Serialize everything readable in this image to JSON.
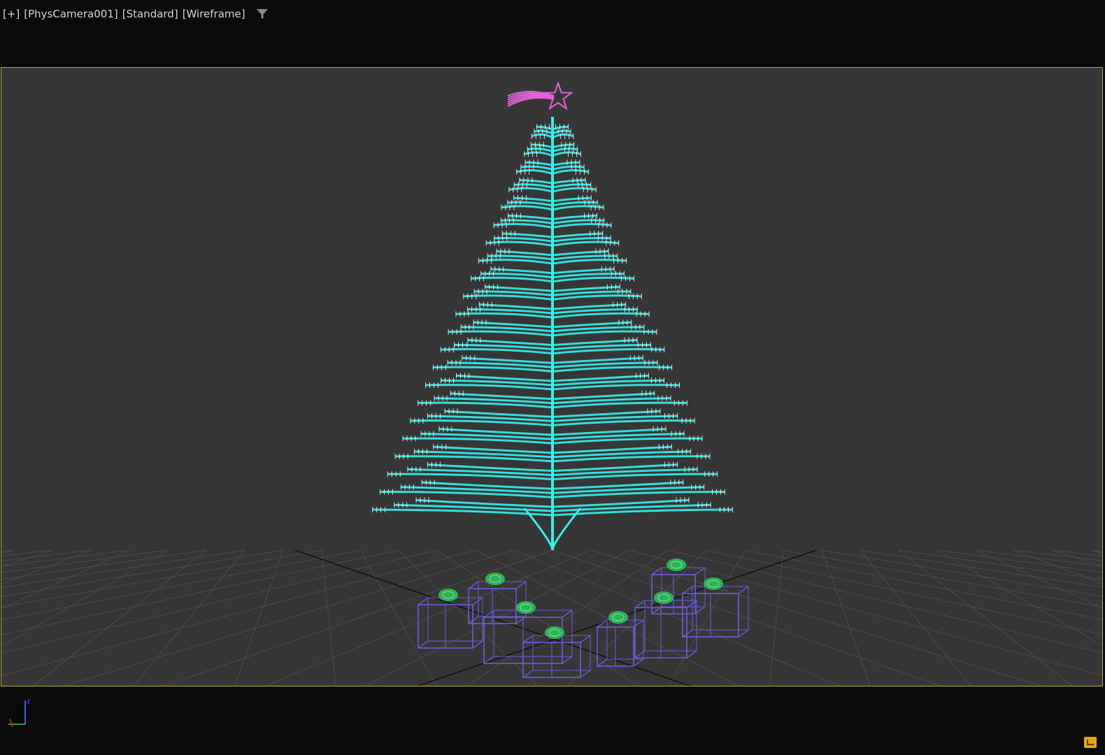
{
  "viewport": {
    "plus_label": "[+]",
    "camera_label": "[PhysCamera001]",
    "shading_label": "[Standard]",
    "mode_label": "[Wireframe]",
    "filter_icon": "funnel-icon"
  },
  "axis": {
    "z_label": "z"
  },
  "colors": {
    "background": "#0a0a0a",
    "viewport_bg": "#363636",
    "safe_frame": "#b9ae3c",
    "tree": "#35f0ec",
    "star": "#e063d8",
    "gifts": "#6c60e8",
    "bows": "#2fbf5a",
    "grid": "#555555"
  },
  "scene": {
    "objects": [
      "tree",
      "star",
      "gift-boxes",
      "bows",
      "grid"
    ]
  }
}
